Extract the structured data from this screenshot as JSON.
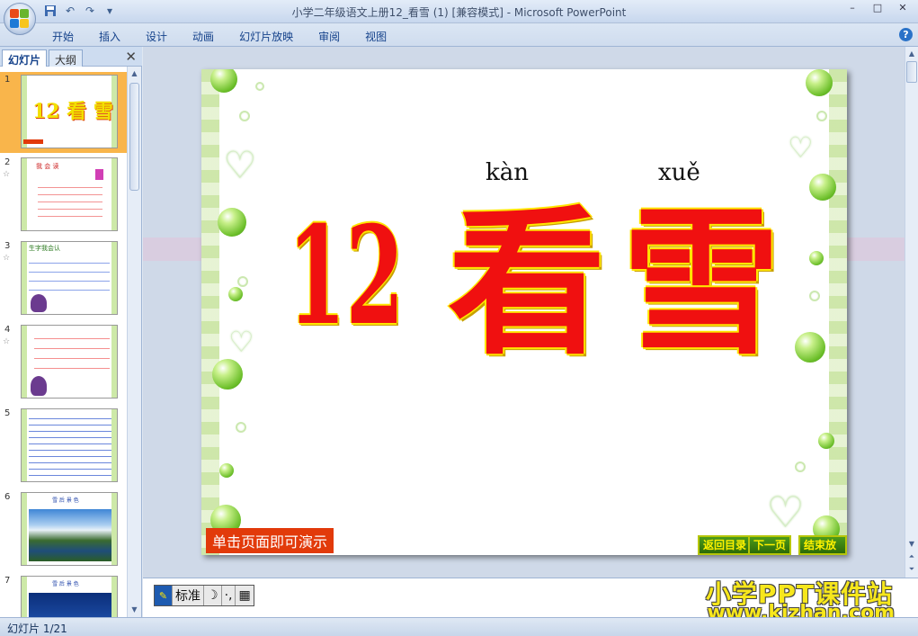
{
  "app": {
    "title": "小学二年级语文上册12_看雪 (1) [兼容模式] - Microsoft PowerPoint",
    "quick_access": [
      "save-icon",
      "undo-icon",
      "redo-icon",
      "customize-icon"
    ],
    "window_controls": [
      "–",
      "□",
      "✕"
    ]
  },
  "ribbon": {
    "tabs": [
      "开始",
      "插入",
      "设计",
      "动画",
      "幻灯片放映",
      "审阅",
      "视图"
    ],
    "help": "?"
  },
  "left_panel": {
    "tab_slides": "幻灯片",
    "tab_outline": "大纲",
    "close": "✕",
    "thumbnails": [
      {
        "num": "1",
        "star": ""
      },
      {
        "num": "2",
        "star": "☆"
      },
      {
        "num": "3",
        "star": "☆"
      },
      {
        "num": "4",
        "star": "☆"
      },
      {
        "num": "5",
        "star": ""
      },
      {
        "num": "6",
        "star": ""
      },
      {
        "num": "7",
        "star": ""
      }
    ],
    "thumb1_big": "12 看 雪",
    "thumb2_text": "我 会 读",
    "thumb3_text": "生字我会认",
    "thumb6_text": "雪 后 景 色",
    "thumb7_text": "雪 后 景 色"
  },
  "slide": {
    "pinyin_1": "kàn",
    "pinyin_2": "xuě",
    "number": "12",
    "char_1": "看",
    "char_2": "雪",
    "hint": "单击页面即可演示",
    "nav_back": "返回目录",
    "nav_next": "下一页",
    "nav_end": "结束放映"
  },
  "notes": {
    "ime_label": "标准",
    "watermark_1": "小学PPT课件站",
    "watermark_2": "www.kjzhan.com"
  },
  "status": {
    "slide_indicator": "幻灯片 1/21"
  },
  "colors": {
    "slide_char": "#f01010",
    "char_outline": "#ffe600",
    "hint_bg": "#e23a0a",
    "border_green": "#c8e4a0",
    "selected_thumb": "#f9b54b"
  }
}
